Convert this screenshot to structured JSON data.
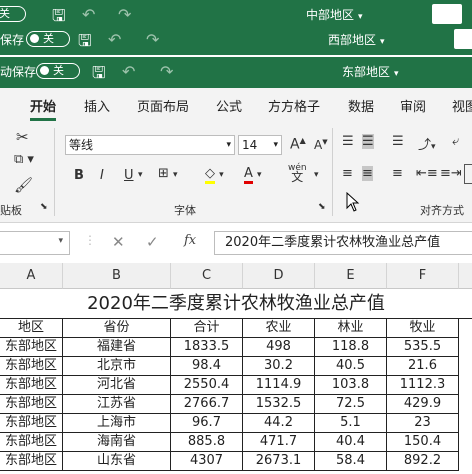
{
  "windows": [
    {
      "autosave_label": "",
      "toggle": "关",
      "title": "中部地区"
    },
    {
      "autosave_label": "保存",
      "toggle": "关",
      "title": "西部地区"
    },
    {
      "autosave_label": "动保存",
      "toggle": "关",
      "title": "东部地区"
    }
  ],
  "tabs": [
    "开始",
    "插入",
    "页面布局",
    "公式",
    "方方格子",
    "数据",
    "审阅",
    "视图"
  ],
  "ribbon": {
    "font_name": "等线",
    "font_size": "14",
    "clipboard_label": "贴板",
    "font_group_label": "字体",
    "align_group_label": "对齐方式",
    "bold": "B",
    "italic": "I",
    "underline": "U",
    "grow": "A",
    "shrink": "A",
    "wen": "wén",
    "wen_char": "文"
  },
  "formula_bar": {
    "fx": "fx",
    "content": "2020年二季度累计农林牧渔业总产值"
  },
  "sheet": {
    "columns": [
      "A",
      "B",
      "C",
      "D",
      "E",
      "F"
    ],
    "title": "2020年二季度累计农林牧渔业总产值",
    "headers": [
      "地区",
      "省份",
      "合计",
      "农业",
      "林业",
      "牧业"
    ],
    "rows": [
      [
        "东部地区",
        "福建省",
        "1833.5",
        "498",
        "118.8",
        "535.5"
      ],
      [
        "东部地区",
        "北京市",
        "98.4",
        "30.2",
        "40.5",
        "21.6"
      ],
      [
        "东部地区",
        "河北省",
        "2550.4",
        "1114.9",
        "103.8",
        "1112.3"
      ],
      [
        "东部地区",
        "江苏省",
        "2766.7",
        "1532.5",
        "72.5",
        "429.9"
      ],
      [
        "东部地区",
        "上海市",
        "96.7",
        "44.2",
        "5.1",
        "23"
      ],
      [
        "东部地区",
        "海南省",
        "885.8",
        "471.7",
        "40.4",
        "150.4"
      ],
      [
        "东部地区",
        "山东省",
        "4307",
        "2673.1",
        "58.4",
        "892.2"
      ]
    ]
  },
  "colors": {
    "excel_green": "#217346",
    "ribbon_bg": "#f3f3f3"
  }
}
